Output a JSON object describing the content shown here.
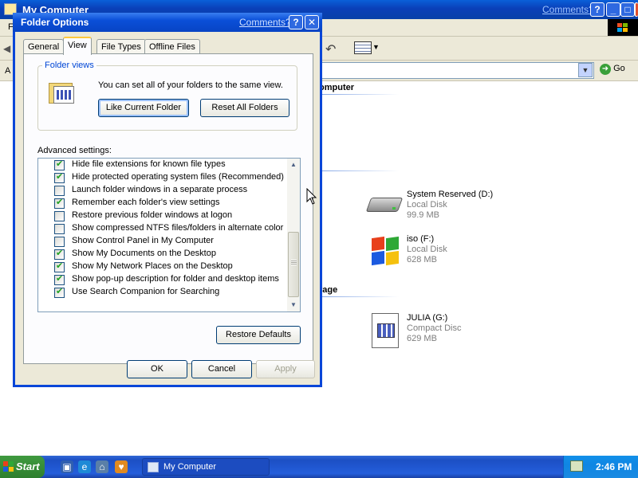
{
  "explorer": {
    "title": "My Computer",
    "comments_link": "Comments?",
    "menu_first_letter": "F",
    "address_label": "A",
    "go_label": "Go",
    "sections": [
      {
        "heading": "omputer"
      },
      {
        "heading": "rage"
      }
    ],
    "drives": [
      {
        "name": "System Reserved (D:)",
        "type": "Local Disk",
        "size": "99.9 MB",
        "icon": "hard-disk-icon"
      },
      {
        "name": "iso (F:)",
        "type": "Local Disk",
        "size": "628 MB",
        "icon": "windows-flag-icon"
      },
      {
        "name": "JULIA (G:)",
        "type": "Compact Disc",
        "size": "629 MB",
        "icon": "cd-document-icon"
      }
    ]
  },
  "dialog": {
    "title": "Folder Options",
    "comments_link": "Comments?",
    "help_label": "?",
    "close_label": "✕",
    "tabs": [
      {
        "label": "General",
        "active": false
      },
      {
        "label": "View",
        "active": true
      },
      {
        "label": "File Types",
        "active": false
      },
      {
        "label": "Offline Files",
        "active": false
      }
    ],
    "folder_views": {
      "legend": "Folder views",
      "description": "You can set all of your folders to the same view.",
      "like_current_label": "Like Current Folder",
      "reset_all_label": "Reset All Folders"
    },
    "advanced_label": "Advanced settings:",
    "advanced_items": [
      {
        "label": "Hide file extensions for known file types",
        "checked": true
      },
      {
        "label": "Hide protected operating system files (Recommended)",
        "checked": true
      },
      {
        "label": "Launch folder windows in a separate process",
        "checked": false
      },
      {
        "label": "Remember each folder's view settings",
        "checked": true
      },
      {
        "label": "Restore previous folder windows at logon",
        "checked": false
      },
      {
        "label": "Show compressed NTFS files/folders in alternate color",
        "checked": false
      },
      {
        "label": "Show Control Panel in My Computer",
        "checked": false
      },
      {
        "label": "Show My Documents on the Desktop",
        "checked": true
      },
      {
        "label": "Show My Network Places on the Desktop",
        "checked": true
      },
      {
        "label": "Show pop-up description for folder and desktop items",
        "checked": true
      },
      {
        "label": "Use Search Companion for Searching",
        "checked": true
      }
    ],
    "restore_defaults_label": "Restore Defaults",
    "ok_label": "OK",
    "cancel_label": "Cancel",
    "apply_label": "Apply"
  },
  "taskbar": {
    "start_label": "Start",
    "task_label": "My Computer",
    "clock": "2:46 PM",
    "quick_launch": [
      "show-desktop-icon",
      "internet-explorer-icon",
      "network-icon",
      "messenger-icon"
    ]
  },
  "colors": {
    "titlebar_blue": "#0a4fd8",
    "dialog_bg": "#ece9d8",
    "legend_blue": "#0046d5",
    "start_green": "#3f9a3f",
    "check_green": "#21a121"
  }
}
